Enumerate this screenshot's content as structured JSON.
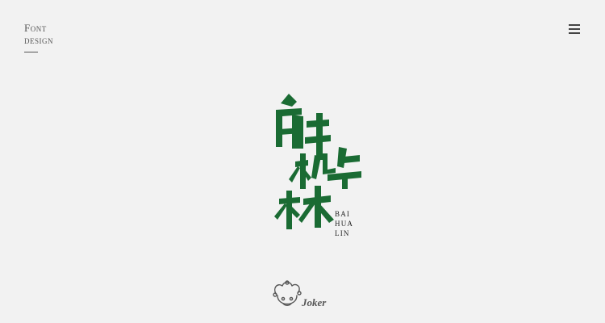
{
  "brand": {
    "line1": "Font",
    "line2": "design"
  },
  "header": {
    "menu_icon": "hamburger-menu-icon"
  },
  "logo": {
    "title_chars": [
      "白",
      "桦",
      "林"
    ],
    "pinyin_lines": [
      "BAI",
      "HUA",
      "LIN"
    ],
    "color": "#1a6b33"
  },
  "footer": {
    "joker_label": "Joker",
    "joker_icon": "jester-head-icon"
  }
}
